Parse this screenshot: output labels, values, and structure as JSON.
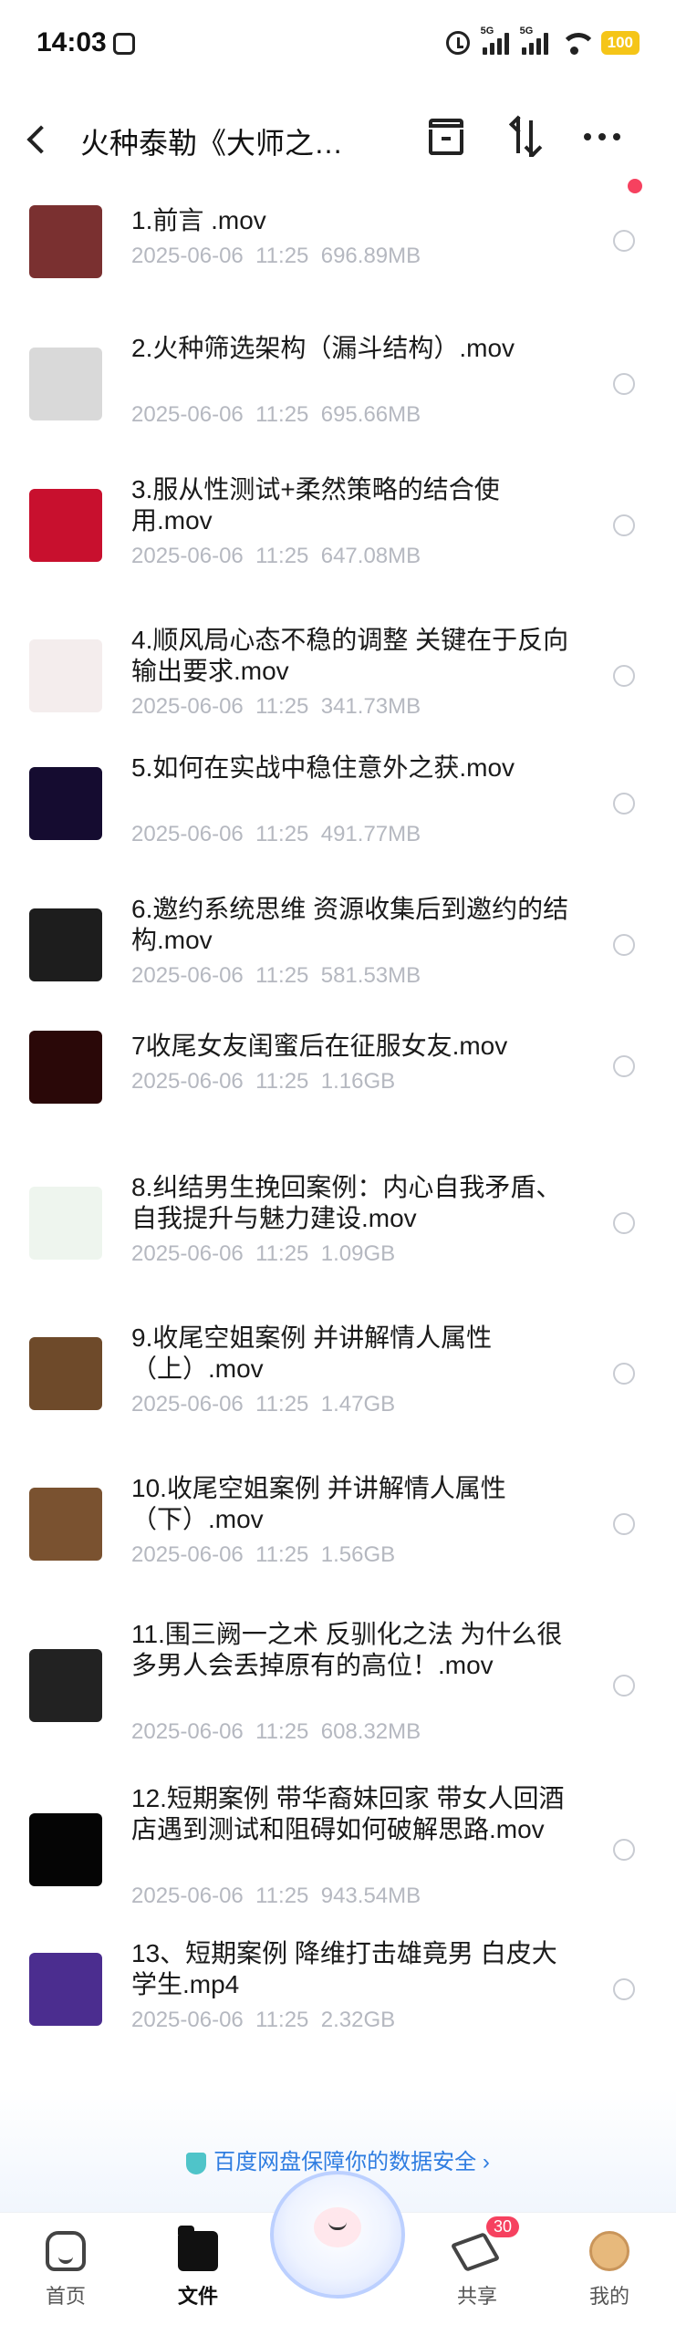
{
  "status_bar": {
    "time": "14:03",
    "battery": "100",
    "signal_label_1": "5G",
    "signal_label_2": "5G"
  },
  "header": {
    "title": "火种泰勒《大师之…"
  },
  "files": [
    {
      "name": "1.前言  .mov",
      "date": "2025-06-06",
      "time": "11:25",
      "size": "696.89MB",
      "thumb_color": "#7a3030"
    },
    {
      "name": "2.火种筛选架构（漏斗结构）.mov",
      "date": "2025-06-06",
      "time": "11:25",
      "size": "695.66MB",
      "thumb_color": "#d9d9d9"
    },
    {
      "name": "3.服从性测试+柔然策略的结合使用.mov",
      "date": "2025-06-06",
      "time": "11:25",
      "size": "647.08MB",
      "thumb_color": "#c8102e"
    },
    {
      "name": "4.顺风局心态不稳的调整  关键在于反向输出要求.mov",
      "date": "2025-06-06",
      "time": "11:25",
      "size": "341.73MB",
      "thumb_color": "#f4eded"
    },
    {
      "name": "5.如何在实战中稳住意外之获.mov",
      "date": "2025-06-06",
      "time": "11:25",
      "size": "491.77MB",
      "thumb_color": "#150c30"
    },
    {
      "name": "6.邀约系统思维 资源收集后到邀约的结构.mov",
      "date": "2025-06-06",
      "time": "11:25",
      "size": "581.53MB",
      "thumb_color": "#1d1d1d"
    },
    {
      "name": "7收尾女友闺蜜后在征服女友.mov",
      "date": "2025-06-06",
      "time": "11:25",
      "size": "1.16GB",
      "thumb_color": "#2a0808"
    },
    {
      "name": "8.纠结男生挽回案例：内心自我矛盾、自我提升与魅力建设.mov",
      "date": "2025-06-06",
      "time": "11:25",
      "size": "1.09GB",
      "thumb_color": "#eef5ee"
    },
    {
      "name": "9.收尾空姐案例  并讲解情人属性（上）.mov",
      "date": "2025-06-06",
      "time": "11:25",
      "size": "1.47GB",
      "thumb_color": "#6e4a2a"
    },
    {
      "name": "10.收尾空姐案例  并讲解情人属性（下）.mov",
      "date": "2025-06-06",
      "time": "11:25",
      "size": "1.56GB",
      "thumb_color": "#7a5230"
    },
    {
      "name": "11.围三阙一之术   反驯化之法  为什么很多男人会丢掉原有的高位！.mov",
      "date": "2025-06-06",
      "time": "11:25",
      "size": "608.32MB",
      "thumb_color": "#222222"
    },
    {
      "name": "12.短期案例 带华裔妹回家  带女人回酒店遇到测试和阻碍如何破解思路.mov",
      "date": "2025-06-06",
      "time": "11:25",
      "size": "943.54MB",
      "thumb_color": "#050505"
    },
    {
      "name": "13、短期案例 降维打击雄竟男 白皮大学生.mp4",
      "date": "2025-06-06",
      "time": "11:25",
      "size": "2.32GB",
      "thumb_color": "#4b2d8f"
    }
  ],
  "promo": {
    "text": "百度网盘保障你的数据安全 ›"
  },
  "nav": {
    "home": "首页",
    "files": "文件",
    "share": "共享",
    "share_badge": "30",
    "me": "我的"
  }
}
